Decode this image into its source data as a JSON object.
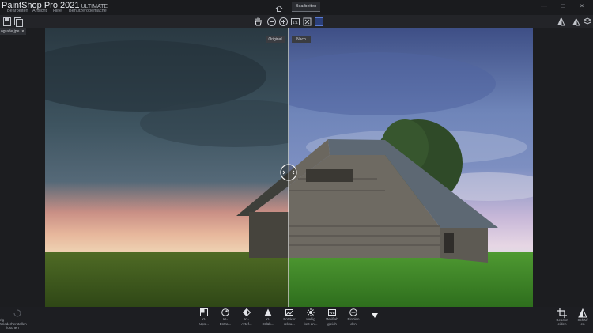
{
  "app": {
    "title": "PaintShop Pro 2021",
    "edition": "ULTIMATE",
    "menu": [
      "Bearbeiten",
      "Ansicht",
      "Hilfe",
      "Benutzeroberfläche"
    ],
    "tab_edit": "Bearbeiten"
  },
  "document": {
    "tab_label": "ografie.jpe",
    "close_label": "×"
  },
  "compare": {
    "before_label": "Original",
    "after_label": "Nach"
  },
  "window_controls": [
    "—",
    "□",
    "×"
  ],
  "toolbar": {
    "icons": [
      "hand-tool-icon",
      "zoom-out-icon",
      "zoom-in-icon",
      "actual-size-icon",
      "fit-icon",
      "split-view-icon"
    ]
  },
  "bottom_tools": [
    {
      "name": "ki-upsampling",
      "line1": "KI-",
      "line2": "Ups..."
    },
    {
      "name": "ki-entrauschen",
      "line1": "KI-",
      "line2": "Entra..."
    },
    {
      "name": "ki-artefakt",
      "line1": "KI-",
      "line2": "Artef..."
    },
    {
      "name": "ki-stil",
      "line1": "KI-",
      "line2": "Stilüb..."
    },
    {
      "name": "fotokorrektur",
      "line1": "Fotokor",
      "line2": "rektu..."
    },
    {
      "name": "helligkeit",
      "line1": "Hellig",
      "line2": "keit an..."
    },
    {
      "name": "weissabgleich",
      "line1": "Weißab",
      "line2": "gleich"
    },
    {
      "name": "einblenden",
      "line1": "Einblen",
      "line2": "den"
    }
  ],
  "left_bottom": {
    "line1": "Wiederherstellen",
    "line2": "löschen",
    "prefix": "rig"
  },
  "right_bottom": [
    {
      "line1": "Beschn",
      "line2": "eiden"
    },
    {
      "line1": "Schärf",
      "line2": "en"
    }
  ],
  "colors": {
    "accent": "#4aa3ff",
    "chrome": "#1c1d20"
  }
}
